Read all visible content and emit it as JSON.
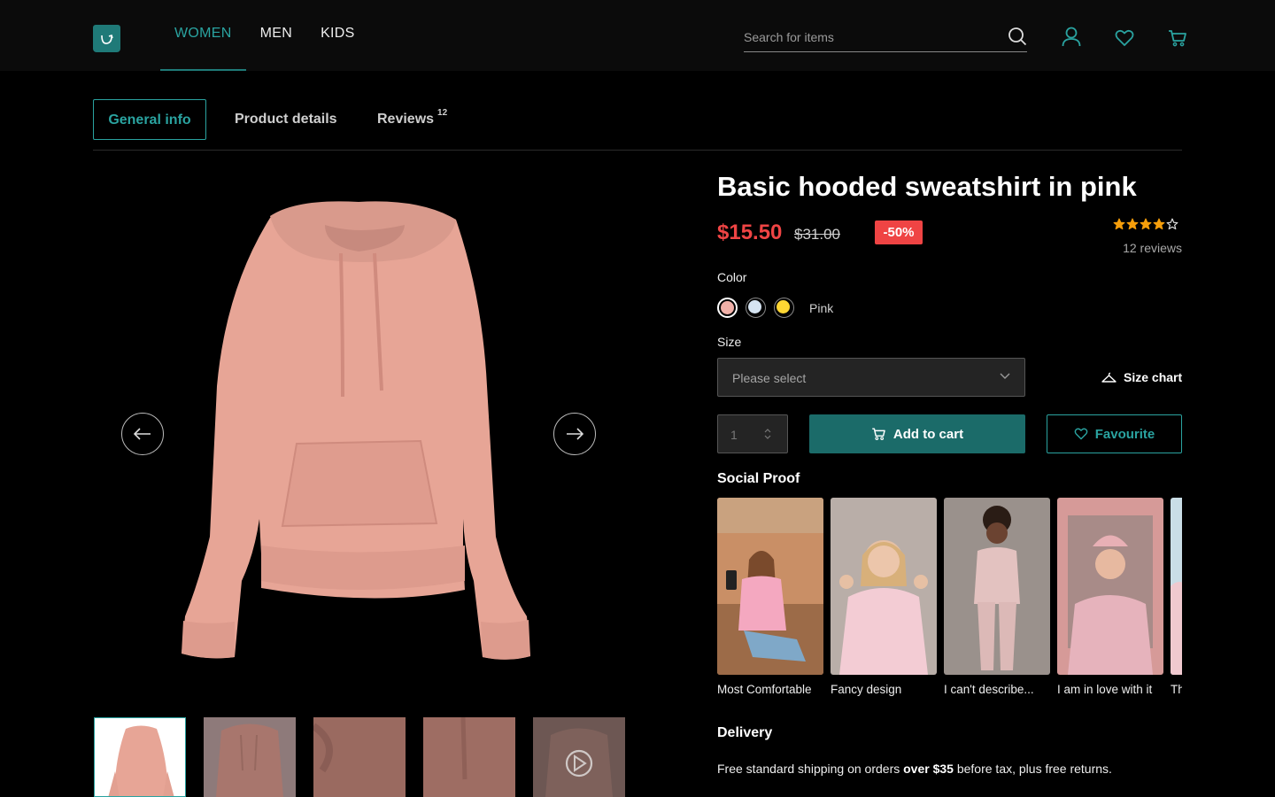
{
  "header": {
    "nav": [
      "WOMEN",
      "MEN",
      "KIDS"
    ],
    "search_placeholder": "Search for items"
  },
  "tabs": {
    "general": "General info",
    "details": "Product details",
    "reviews": "Reviews",
    "reviews_count": "12"
  },
  "product": {
    "title": "Basic hooded sweatshirt in pink",
    "price": "$15.50",
    "old_price": "$31.00",
    "discount": "-50%",
    "rating": 4,
    "rating_max": 5,
    "reviews_label": "12 reviews",
    "color_label": "Color",
    "selected_color": "Pink",
    "colors": [
      "#f0b0a8",
      "#d6e4f2",
      "#ffd633"
    ],
    "size_label": "Size",
    "size_placeholder": "Please select",
    "size_chart": "Size chart",
    "quantity": "1",
    "add_to_cart": "Add to cart",
    "favourite": "Favourite"
  },
  "social": {
    "title": "Social Proof",
    "items": [
      {
        "caption": "Most Comfortable"
      },
      {
        "caption": "Fancy design"
      },
      {
        "caption": "I can't describe..."
      },
      {
        "caption": "I am in love with it"
      },
      {
        "caption": "Th"
      }
    ]
  },
  "delivery": {
    "title": "Delivery",
    "text_before": "Free standard shipping on orders ",
    "text_bold": "over $35",
    "text_after": " before tax, plus free returns."
  },
  "colors": {
    "accent": "#1f7a78",
    "accent_light": "#2aa3a0",
    "sale": "#ef4444",
    "star": "#f59e0b"
  }
}
